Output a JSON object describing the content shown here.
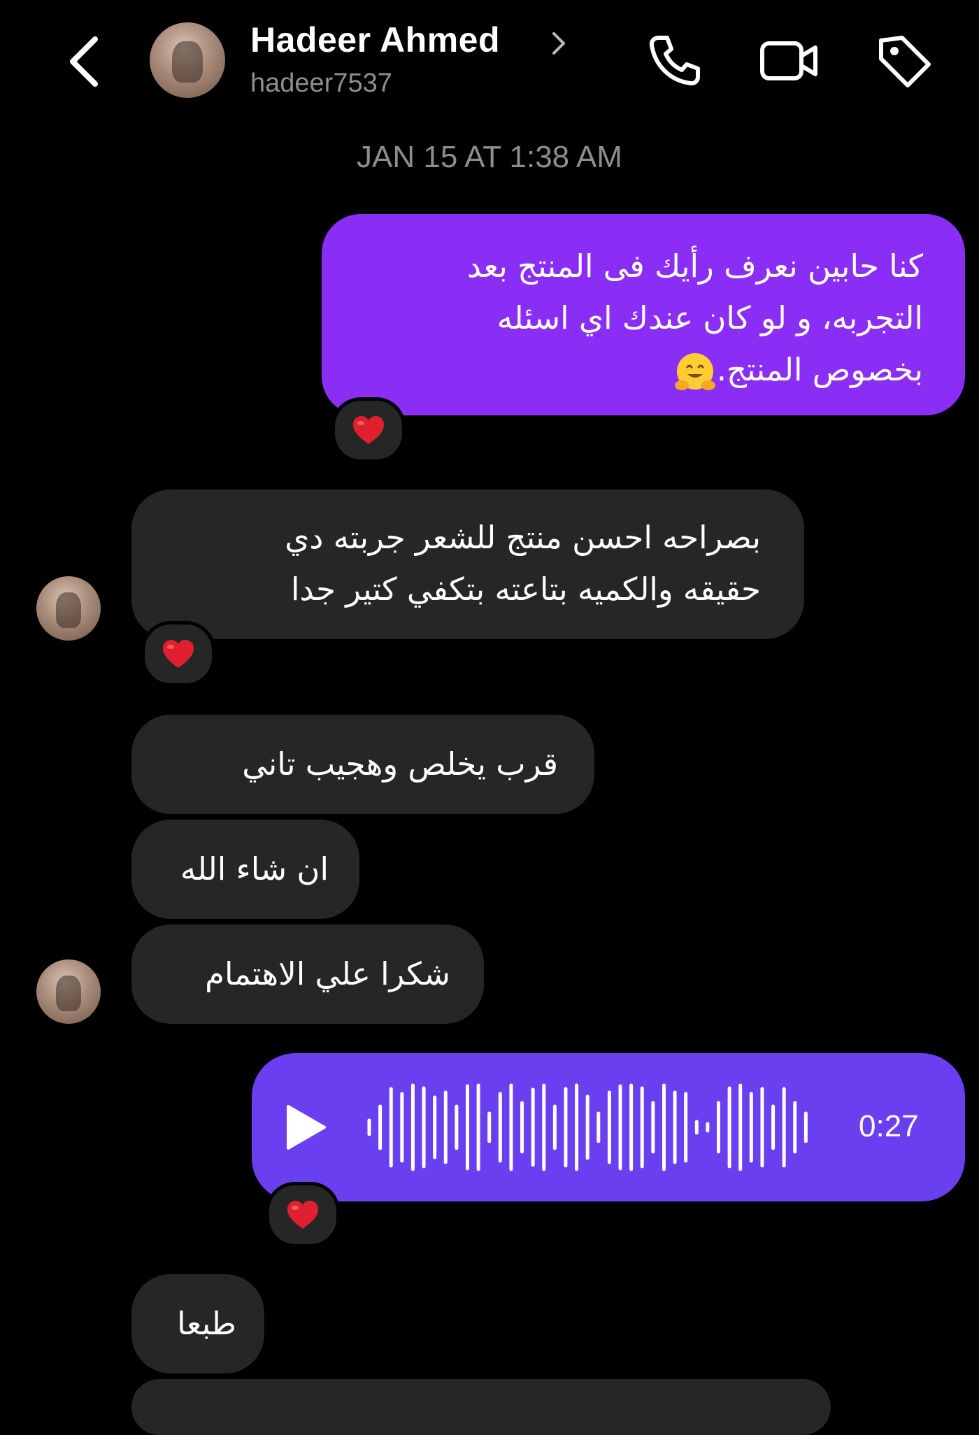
{
  "header": {
    "contact_name": "Hadeer Ahmed",
    "username": "hadeer7537",
    "icons": [
      "back-chevron-icon",
      "phone-icon",
      "video-camera-icon",
      "tag-icon"
    ]
  },
  "conversation": {
    "timestamp": "JAN 15 AT 1:38 AM",
    "messages": [
      {
        "direction": "outgoing",
        "lines": [
          "كنا حابين نعرف رأيك فى المنتج بعد",
          "التجربه، و لو كان عندك اي اسئله",
          "بخصوص المنتج."
        ],
        "emoji": "hugging-face-emoji",
        "reaction": "red-heart"
      },
      {
        "direction": "incoming",
        "lines": [
          "بصراحه احسن منتج للشعر جربته دي",
          "حقيقه والكميه بتاعته بتكفي كتير جدا"
        ],
        "reaction": "red-heart"
      },
      {
        "direction": "incoming",
        "lines": [
          "قرب يخلص وهجيب تاني"
        ]
      },
      {
        "direction": "incoming",
        "lines": [
          "ان شاء الله"
        ]
      },
      {
        "direction": "incoming",
        "lines": [
          "شكرا علي الاهتمام"
        ]
      },
      {
        "direction": "outgoing",
        "type": "voice",
        "duration": "0:27",
        "reaction": "red-heart"
      },
      {
        "direction": "incoming",
        "lines": [
          "طبعا"
        ]
      }
    ]
  },
  "colors": {
    "background": "#000000",
    "outgoing_bubble": "#8b2ef5",
    "voice_bubble": "#6a3ff0",
    "incoming_bubble": "#262626",
    "secondary_text": "#8e8e8e",
    "reaction_heart": "#e0202e"
  }
}
